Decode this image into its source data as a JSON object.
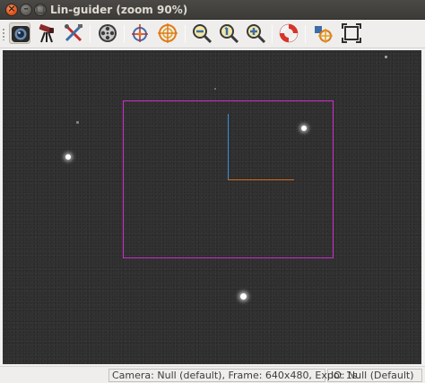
{
  "window": {
    "title": "Lin-guider (zoom 90%)",
    "controls": {
      "close": "×",
      "minimize": "–",
      "maximize": "□"
    }
  },
  "toolbar": {
    "buttons": [
      {
        "name": "video-settings",
        "icon": "camera-icon",
        "active": true
      },
      {
        "name": "guider-settings",
        "icon": "telescope-icon"
      },
      {
        "name": "settings",
        "icon": "tools-icon"
      },
      {
        "name": "video-capture",
        "icon": "film-reel-icon"
      },
      {
        "name": "calibration",
        "icon": "calibration-icon"
      },
      {
        "name": "guiding",
        "icon": "crosshair-icon"
      },
      {
        "name": "zoom-out",
        "icon": "zoom-out-icon"
      },
      {
        "name": "zoom-1-1",
        "icon": "zoom-fit-icon"
      },
      {
        "name": "zoom-in",
        "icon": "zoom-in-icon"
      },
      {
        "name": "help",
        "icon": "lifebuoy-icon"
      },
      {
        "name": "reticle",
        "icon": "reticle-icon"
      },
      {
        "name": "fullscreen",
        "icon": "fullscreen-icon"
      }
    ]
  },
  "status": {
    "camera": "Camera: Null (default), Frame: 640x480, Expo: 1s",
    "io": "IO: Null (Default)"
  },
  "colors": {
    "guide_rect": "#d22ad0",
    "axis_y": "#3a8fd8",
    "axis_x": "#d86a1a",
    "background": "#2f2f2f"
  }
}
